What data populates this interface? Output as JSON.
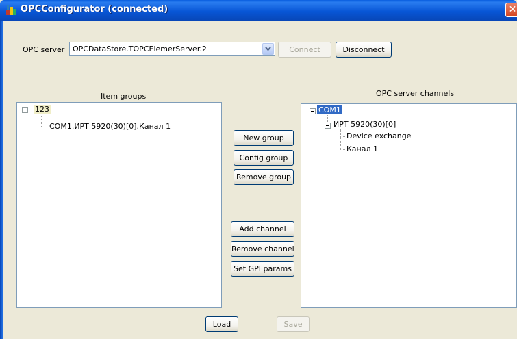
{
  "window": {
    "title": "OPCConfigurator (connected)",
    "close_glyph": "✕",
    "icon": "app-icon"
  },
  "server": {
    "label": "OPC server",
    "value": "OPCDataStore.TOPCElemerServer.2",
    "connect_label": "Connect",
    "connect_enabled": false,
    "disconnect_label": "Disconnect"
  },
  "item_groups": {
    "title": "Item groups",
    "root_label": "123",
    "child_label": "COM1.ИРТ 5920(30)[0].Канал 1"
  },
  "channels": {
    "title": "OPC server channels",
    "root_label": "COM1",
    "device_label": "ИРТ 5920(30)[0]",
    "leaf_1": "Device exchange",
    "leaf_2": "Канал 1"
  },
  "actions": {
    "new_group": "New group",
    "config_group": "Config group",
    "remove_group": "Remove group",
    "add_channel": "Add channel",
    "remove_channel": "Remove channel",
    "set_gpi_params": "Set GPI params"
  },
  "footer": {
    "load_label": "Load",
    "save_label": "Save",
    "save_enabled": false
  },
  "colors": {
    "titlebar": "#0856d6",
    "window_bg": "#ece9d8",
    "selection": "#316ac5"
  }
}
